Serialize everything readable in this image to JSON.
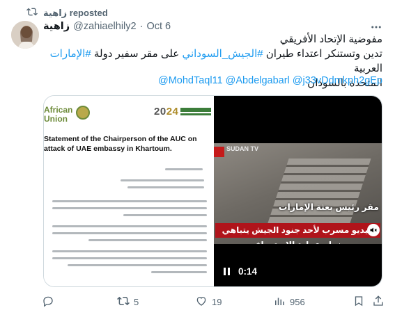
{
  "repost": {
    "label": "زاهية reposted"
  },
  "tweet": {
    "display_name": "زاهية",
    "handle": "@zahiaelhily2",
    "separator": "·",
    "date": "Oct 6",
    "line1": "مفوضية الإتحاد الأفريقي",
    "line2_a": "تدين وتستنكر اعتداء طيران",
    "hashtag1": "#الجيش_السوداني",
    "line2_b": "على مقر سفير دولة",
    "hashtag2": "#الإمارات",
    "line2_c": "العربية",
    "line3": "المتحدة بالسودان",
    "mentions": "@MohdTaql11 @Abdelgabarl  @j33vDdmkph2gEp"
  },
  "document_image": {
    "org": "African Union",
    "year_a": "20",
    "year_b": "24",
    "heading": "Statement of the Chairperson of the AUC on attack of UAE embassy in Khartoum."
  },
  "video": {
    "channel": "SUDAN TV",
    "caption_top": "مقر رئيس بعثة الإمارات",
    "caption_bottom": "فيديو مسرب لأحد جنود الجيش يتباهي بنجاح عملية الاستهداف",
    "time": "0:14"
  },
  "actions": {
    "replies": "",
    "reposts": "5",
    "likes": "19",
    "views": "956"
  },
  "colors": {
    "link": "#1d9bf0",
    "muted": "#536471",
    "caption_red": "#b0141b"
  }
}
